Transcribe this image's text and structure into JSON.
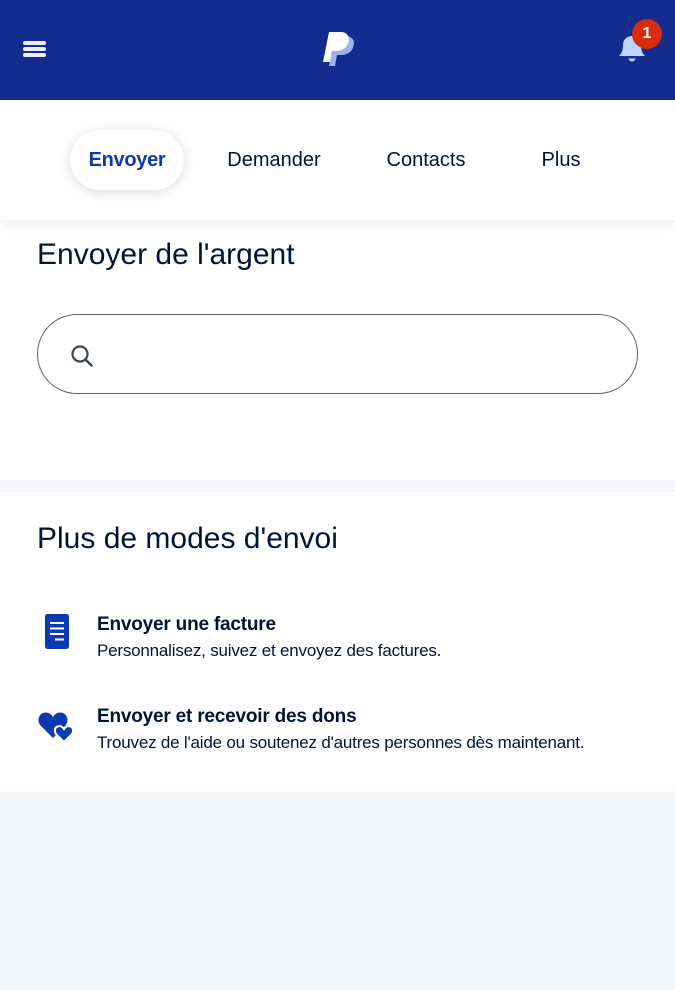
{
  "header": {
    "notification_count": "1",
    "brand_color": "#142c8e",
    "badge_color": "#d62d10",
    "icons": [
      "menu-icon",
      "paypal-logo",
      "bell-icon"
    ]
  },
  "tabs": [
    {
      "label": "Envoyer",
      "active": true
    },
    {
      "label": "Demander",
      "active": false
    },
    {
      "label": "Contacts",
      "active": false
    },
    {
      "label": "Plus",
      "active": false
    }
  ],
  "send": {
    "title": "Envoyer de l'argent",
    "search_value": "",
    "search_icon": "search-icon"
  },
  "more": {
    "title": "Plus de modes d'envoi",
    "options": [
      {
        "icon": "invoice-icon",
        "title": "Envoyer une facture",
        "description": "Personnalisez, suivez et envoyez des factures."
      },
      {
        "icon": "heart-donation-icon",
        "title": "Envoyer et recevoir des dons",
        "description": "Trouvez de l'aide ou soutenez d'autres personnes dès maintenant."
      }
    ]
  }
}
